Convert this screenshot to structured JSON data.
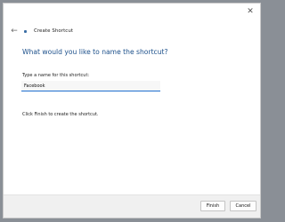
{
  "window": {
    "close_glyph": "✕",
    "back_glyph": "←",
    "wizard_title": "Create Shortcut",
    "wizard_icon": "shortcut-wizard-icon"
  },
  "content": {
    "heading": "What would you like to name the shortcut?",
    "name_label": "Type a name for this shortcut:",
    "name_value": "Facebook",
    "finish_note": "Click Finish to create the shortcut."
  },
  "footer": {
    "finish_label": "Finish",
    "cancel_label": "Cancel"
  },
  "colors": {
    "heading": "#1b4f8a",
    "input_underline": "#1f6fcf",
    "footer_bg": "#f0f0f0"
  }
}
